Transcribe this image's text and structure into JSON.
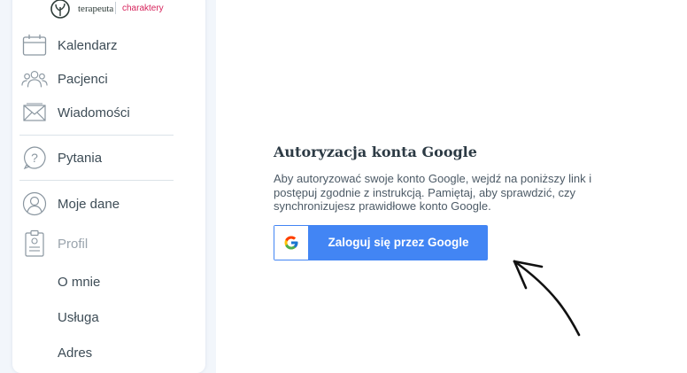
{
  "logo": {
    "brand": "terapeuta",
    "brand2": "charaktery"
  },
  "sidebar": {
    "items": [
      {
        "label": "Kalendarz",
        "icon": "calendar-icon"
      },
      {
        "label": "Pacjenci",
        "icon": "patients-icon"
      },
      {
        "label": "Wiadomości",
        "icon": "envelope-icon"
      },
      {
        "label": "Pytania",
        "icon": "question-icon"
      },
      {
        "label": "Moje dane",
        "icon": "user-icon"
      },
      {
        "label": "Profil",
        "icon": "profile-document-icon"
      }
    ],
    "subitems": [
      "O mnie",
      "Usługa",
      "Adres"
    ]
  },
  "main": {
    "title": "Autoryzacja konta Google",
    "description": "Aby autoryzować swoje konto Google, wejdź na poniższy link i postępuj zgodnie z instrukcją. Pamiętaj, aby sprawdzić, czy synchronizujesz prawidłowe konto Google.",
    "google_button_label": "Zaloguj się przez Google"
  },
  "colors": {
    "accent_blue": "#4285f4",
    "brand_pink": "#d6245c",
    "text": "#3d4c56",
    "muted": "#9aa4ad"
  }
}
